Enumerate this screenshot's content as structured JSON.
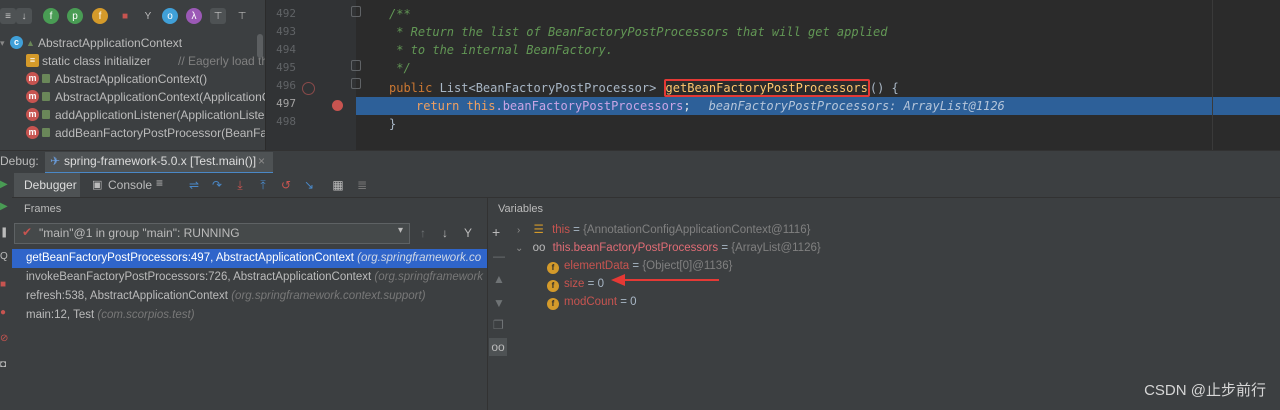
{
  "structure": {
    "items": [
      {
        "icon": "class-icon",
        "label": "AbstractApplicationContext",
        "hint": ""
      },
      {
        "icon": "static-init-icon",
        "label": "static class initializer",
        "hint": "// Eagerly load the ..."
      },
      {
        "icon": "method-icon",
        "label": "AbstractApplicationContext()",
        "hint": ""
      },
      {
        "icon": "method-icon",
        "label": "AbstractApplicationContext(ApplicationCo",
        "hint": ""
      },
      {
        "icon": "method-icon",
        "label": "addApplicationListener(ApplicationListen",
        "hint": ""
      },
      {
        "icon": "method-icon",
        "label": "addBeanFactoryPostProcessor(BeanFacto",
        "hint": ""
      }
    ]
  },
  "editor": {
    "line_numbers": [
      "492",
      "493",
      "494",
      "495",
      "496",
      "497",
      "498"
    ],
    "lines": {
      "l492": "/**",
      "l493": " * Return the list of BeanFactoryPostProcessors that will get applied",
      "l494": " * to the internal BeanFactory.",
      "l495": " */",
      "l496_kw": "public",
      "l496_type": " List<BeanFactoryPostProcessor> ",
      "l496_method": "getBeanFactoryPostProcessors",
      "l496_rest": "() {",
      "l497_kw": "return ",
      "l497_this": "this",
      "l497_field": ".beanFactoryPostProcessors",
      "l497_semi": ";",
      "l497_inline": "beanFactoryPostProcessors: ArrayList@1126",
      "l498": "}"
    }
  },
  "debug": {
    "tab_label": "Debug:",
    "session": "spring-framework-5.0.x [Test.main()]",
    "tabs": {
      "debugger": "Debugger",
      "console": "Console"
    },
    "frames_title": "Frames",
    "variables_title": "Variables",
    "thread": "\"main\"@1 in group \"main\": RUNNING",
    "frames": [
      {
        "method": "getBeanFactoryPostProcessors:497, AbstractApplicationContext",
        "pkg": "(org.springframework.co"
      },
      {
        "method": "invokeBeanFactoryPostProcessors:726, AbstractApplicationContext",
        "pkg": "(org.springframework"
      },
      {
        "method": "refresh:538, AbstractApplicationContext",
        "pkg": "(org.springframework.context.support)"
      },
      {
        "method": "main:12, Test",
        "pkg": "(com.scorpios.test)"
      }
    ],
    "variables": {
      "this_name": "this",
      "this_eq": " = ",
      "this_val": "{AnnotationConfigApplicationContext@1116}",
      "bfpp_name": "this.beanFactoryPostProcessors",
      "bfpp_eq": " = ",
      "bfpp_val": "{ArrayList@1126}",
      "children": [
        {
          "name": "elementData",
          "eq": " = ",
          "value": "{Object[0]@1136}"
        },
        {
          "name": "size",
          "eq": " = ",
          "value": "0"
        },
        {
          "name": "modCount",
          "eq": " = ",
          "value": "0"
        }
      ]
    }
  },
  "watermark": "CSDN @止步前行",
  "colors": {
    "selection": "#2f65ca",
    "highlight_line": "#2d6099",
    "annotation": "#e53935"
  }
}
